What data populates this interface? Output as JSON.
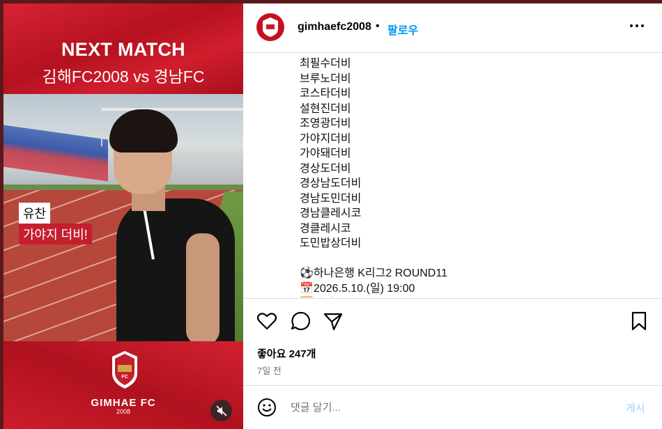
{
  "media": {
    "title": "NEXT MATCH",
    "subtitle": "김해FC2008 vs 경남FC",
    "caption_name": "유찬",
    "caption_text": "가야지 더비!",
    "club_name": "GIMHAE FC",
    "club_year": "2008",
    "mute_icon": "speaker-muted-icon"
  },
  "header": {
    "username": "gimhaefc2008",
    "separator": "•",
    "follow_label": "팔로우",
    "more_icon": "more-dots-icon"
  },
  "caption_lines": [
    "최필수더비",
    "브루노더비",
    "코스타더비",
    "설현진더비",
    "조영광더비",
    "가야지더비",
    "가야돼더비",
    "경상도더비",
    "경상남도더비",
    "경남도민더비",
    "경남클레시코",
    "경클레시코",
    "도민밥상더비",
    "",
    "⚽하나은행 K리그2 ROUND11",
    "📅2026.5.10.(일) 19:00",
    "🆚경남FC"
  ],
  "actions": {
    "likes": "좋아요 247개",
    "time": "7일 전"
  },
  "comment": {
    "placeholder": "댓글 달기...",
    "post_label": "게시"
  },
  "colors": {
    "brand_red": "#c41e2c",
    "link_blue": "#0095f6",
    "post_disabled": "#9fcff8"
  }
}
